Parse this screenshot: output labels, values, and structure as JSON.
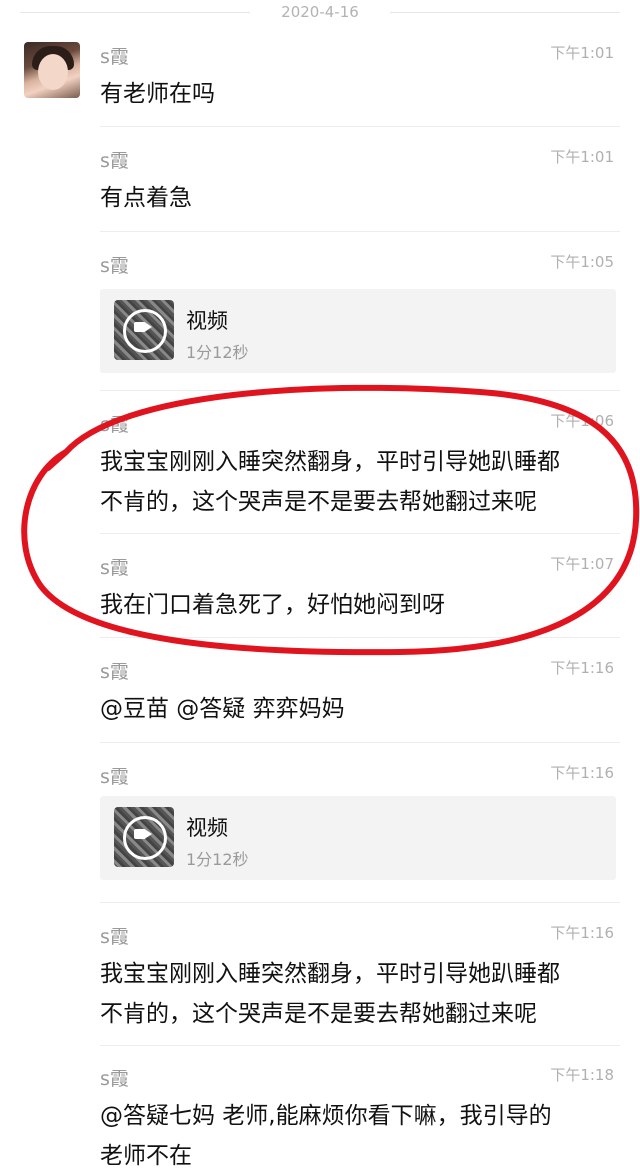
{
  "date": "2020-4-16",
  "messages": [
    {
      "name": "s霞",
      "time": "下午1:01",
      "text": "有老师在吗"
    },
    {
      "name": "s霞",
      "time": "下午1:01",
      "text": "有点着急"
    },
    {
      "name": "s霞",
      "time": "下午1:05",
      "video": {
        "title": "视频",
        "duration": "1分12秒"
      }
    },
    {
      "name": "s霞",
      "time": "下午1:06",
      "text": "我宝宝刚刚入睡突然翻身，平时引导她趴睡都\n不肯的，这个哭声是不是要去帮她翻过来呢"
    },
    {
      "name": "s霞",
      "time": "下午1:07",
      "text": "我在门口着急死了，好怕她闷到呀"
    },
    {
      "name": "s霞",
      "time": "下午1:16",
      "text": "@豆苗 @答疑 弈弈妈妈"
    },
    {
      "name": "s霞",
      "time": "下午1:16",
      "video": {
        "title": "视频",
        "duration": "1分12秒"
      }
    },
    {
      "name": "s霞",
      "time": "下午1:16",
      "text": "我宝宝刚刚入睡突然翻身，平时引导她趴睡都\n不肯的，这个哭声是不是要去帮她翻过来呢"
    },
    {
      "name": "s霞",
      "time": "下午1:18",
      "text": "@答疑七妈 老师,能麻烦你看下嘛，我引导的\n老师不在"
    }
  ],
  "annotation_color": "#e0141e"
}
